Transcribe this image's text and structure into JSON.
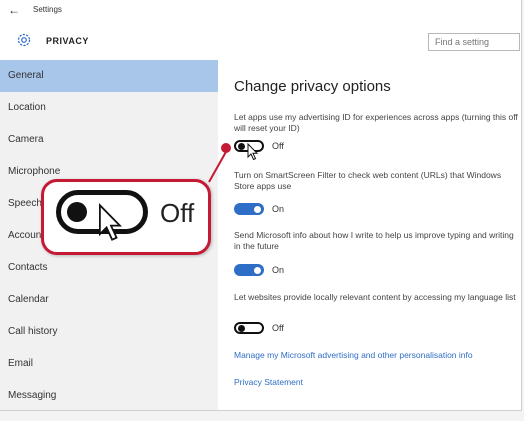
{
  "window": {
    "title": "Settings",
    "page_title": "PRIVACY",
    "search_placeholder": "Find a setting"
  },
  "sidebar": {
    "items": [
      {
        "label": "General",
        "active": true
      },
      {
        "label": "Location"
      },
      {
        "label": "Camera"
      },
      {
        "label": "Microphone"
      },
      {
        "label": "Speech"
      },
      {
        "label": "Accounts"
      },
      {
        "label": "Contacts"
      },
      {
        "label": "Calendar"
      },
      {
        "label": "Call history"
      },
      {
        "label": "Email"
      },
      {
        "label": "Messaging"
      }
    ]
  },
  "content": {
    "heading": "Change privacy options",
    "options": [
      {
        "text": "Let apps use my advertising ID for experiences across apps (turning this off will reset your ID)",
        "state": "Off"
      },
      {
        "text": "Turn on SmartScreen Filter to check web content (URLs) that Windows Store apps use",
        "state": "On"
      },
      {
        "text": "Send Microsoft info about how I write to help us improve typing and writing in the future",
        "state": "On"
      },
      {
        "text": "Let websites provide locally relevant content by accessing my language list",
        "state": "Off"
      }
    ],
    "links": [
      "Manage my Microsoft advertising and other personalisation info",
      "Privacy Statement"
    ]
  },
  "callout": {
    "label": "Off"
  },
  "colors": {
    "accent": "#2f6ec6",
    "active_nav": "#a8c6ea",
    "callout_border": "#c51a35"
  },
  "icons": {
    "back": "back-arrow-icon",
    "settings": "gear-icon",
    "cursor": "mouse-pointer-icon"
  }
}
